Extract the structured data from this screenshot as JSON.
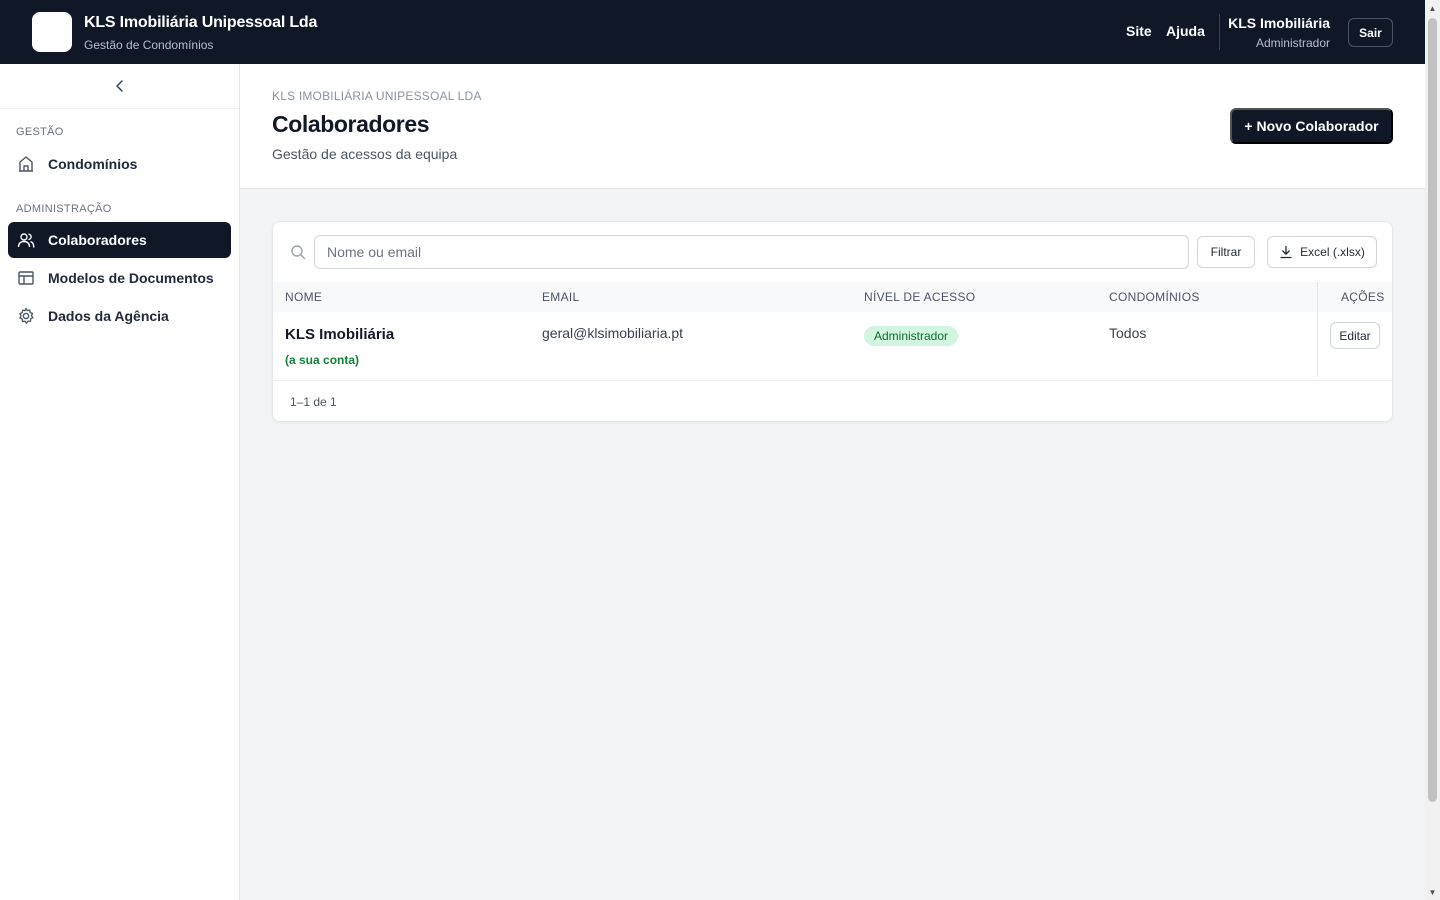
{
  "topbar": {
    "company": "KLS Imobiliária Unipessoal Lda",
    "subtitle": "Gestão de Condomínios",
    "links": [
      "Site",
      "Ajuda"
    ],
    "user_name": "KLS Imobiliária",
    "user_role": "Administrador",
    "logout_label": "Sair"
  },
  "sidebar": {
    "sections": [
      {
        "label": "GESTÃO",
        "items": [
          {
            "label": "Condomínios",
            "icon": "building-icon"
          }
        ]
      },
      {
        "label": "ADMINISTRAÇÃO",
        "items": [
          {
            "label": "Colaboradores",
            "icon": "users-icon",
            "active": true
          },
          {
            "label": "Modelos de Documentos",
            "icon": "layout-icon"
          },
          {
            "label": "Dados da Agência",
            "icon": "gear-icon"
          }
        ]
      }
    ]
  },
  "header": {
    "eyebrow": "KLS IMOBILIÁRIA UNIPESSOAL LDA",
    "title": "Colaboradores",
    "subtitle": "Gestão de acessos da equipa",
    "new_button": "+ Novo Colaborador"
  },
  "toolbar": {
    "search_placeholder": "Nome ou email",
    "search_value": "",
    "filter_label": "Filtrar",
    "excel_label": "Excel (.xlsx)"
  },
  "table": {
    "columns": [
      "NOME",
      "EMAIL",
      "NÍVEL DE ACESSO",
      "CONDOMÍNIOS",
      "AÇÕES"
    ],
    "rows": [
      {
        "name": "KLS Imobiliária",
        "note": "(a sua conta)",
        "email": "geral@klsimobiliaria.pt",
        "access": "Administrador",
        "condos": "Todos",
        "action": "Editar"
      }
    ],
    "pagination": "1–1 de 1"
  },
  "colors": {
    "navy": "#101828",
    "badge_bg": "#d1f5df",
    "badge_text": "#0f6b35",
    "own_account": "#15803d"
  }
}
